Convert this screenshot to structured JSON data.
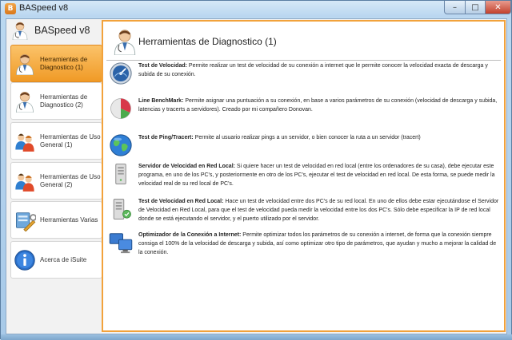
{
  "window": {
    "title": "BASpeed v8",
    "app_icon_letter": "B",
    "min_glyph": "–",
    "max_glyph": "□",
    "close_glyph": "✕"
  },
  "sidebar": {
    "brand": "BASpeed v8",
    "items": [
      {
        "label": "Herramientas de Diagnostico (1)",
        "icon": "doctor-icon",
        "active": true
      },
      {
        "label": "Herramientas de Diagnostico (2)",
        "icon": "doctor-icon",
        "active": false
      },
      {
        "label": "Herramientas de Uso General (1)",
        "icon": "users-icon",
        "active": false
      },
      {
        "label": "Herramientas de Uso General (2)",
        "icon": "users-icon",
        "active": false
      },
      {
        "label": "Herramientas Varias",
        "icon": "tools-icon",
        "active": false
      },
      {
        "label": "Acerca de iSuite",
        "icon": "info-icon",
        "active": false
      }
    ]
  },
  "main": {
    "title": "Herramientas de Diagnostico (1)",
    "tools": [
      {
        "name": "Test de Velocidad:",
        "desc": " Permite realizar un test de velocidad de su conexión a internet que le permite conocer la velocidad exacta de descarga y subida de su conexión.",
        "icon": "speedometer-icon"
      },
      {
        "name": "Line BenchMark:",
        "desc": "  Permite asignar una puntuación a su conexión, en base a varios parámetros de su conexión (velocidad de descarga y subida, latencias y tracerts a servidores). Creado por mi  compañero Donovan.",
        "icon": "pie-chart-icon"
      },
      {
        "name": "Test de Ping/Tracert:",
        "desc": " Permite al usuario realizar pings a un servidor, o bien conocer la ruta a un servidor (tracert)",
        "icon": "globe-icon"
      },
      {
        "name": "Servidor de Velocidad en Red Local:",
        "desc": "  Si quiere hacer un test de velocidad en red local (entre los ordenadores de su casa), debe ejecutar este programa, en uno de los PC's, y posteriormente en otro de los PC's, ejecutar el test de velocidad en red local. De esta forma, se puede medir  la velocidad real de su red local de PC's.",
        "icon": "server-icon"
      },
      {
        "name": "Test de Velocidad en Red Local:",
        "desc": "  Hace un test de velocidad entre dos PC's de su red local. En uno de ellos debe estar ejecutándose el Servidor de Velocidad en Red Local, para que el test de velocidad pueda medir  la velocidad entre los dos PC's. Sólo debe especificar la IP de red local donde se está ejecutando el servidor, y el puerto utilizado por el servidor.",
        "icon": "server-check-icon"
      },
      {
        "name": "Optimizador de la Conexión a Internet:",
        "desc": " Permite optimizar  todos los parámetros de su conexión a internet, de forma que la conexión siempre consiga el 100% de la velocidad de descarga y subida, así como optimizar  otro tipo de parámetros, que ayudan y mucho  a mejorar la calidad de la conexión.",
        "icon": "monitors-icon"
      }
    ]
  }
}
